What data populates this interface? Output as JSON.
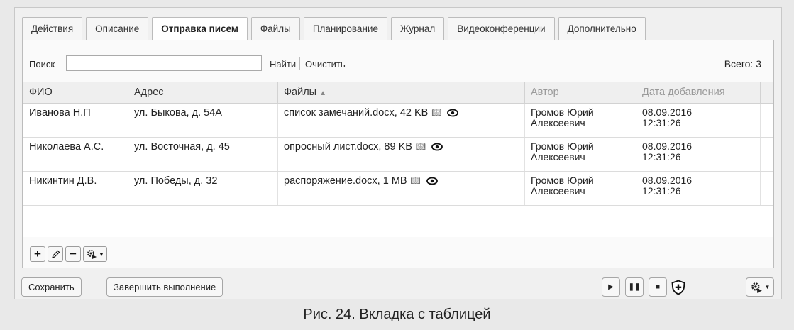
{
  "tabs": [
    "Действия",
    "Описание",
    "Отправка писем",
    "Файлы",
    "Планирование",
    "Журнал",
    "Видеоконференции",
    "Дополнительно"
  ],
  "active_tab": "Отправка писем",
  "search": {
    "label": "Поиск",
    "value": "",
    "find_label": "Найти",
    "clear_label": "Очистить",
    "total_text": "Всего: 3"
  },
  "table": {
    "columns": [
      "ФИО",
      "Адрес",
      "Файлы",
      "Автор",
      "Дата добавления"
    ],
    "sorted_column": "Файлы",
    "rows": [
      {
        "fio": "Иванова Н.П",
        "address": "ул. Быкова, д. 54А",
        "file": "список замечаний.docx, 42 KB",
        "author_line1": "Громов Юрий",
        "author_line2": "Алексеевич",
        "date_line1": "08.09.2016",
        "date_line2": "12:31:26"
      },
      {
        "fio": "Николаева А.С.",
        "address": "ул. Восточная, д. 45",
        "file": "опросный лист.docx, 89 KB",
        "author_line1": "Громов Юрий",
        "author_line2": "Алексеевич",
        "date_line1": "08.09.2016",
        "date_line2": "12:31:26"
      },
      {
        "fio": "Никинтин Д.В.",
        "address": "ул. Победы, д. 32",
        "file": "распоряжение.docx, 1 MB",
        "author_line1": "Громов Юрий",
        "author_line2": "Алексеевич",
        "date_line1": "08.09.2016",
        "date_line2": "12:31:26"
      }
    ]
  },
  "toolbar": {
    "icons": [
      "plus-icon",
      "pencil-icon",
      "minus-icon",
      "gear-play-icon"
    ]
  },
  "footer": {
    "save_label": "Сохранить",
    "finish_label": "Завершить выполнение",
    "controls": [
      "play-icon",
      "pause-icon",
      "stop-icon",
      "shield-plus-icon",
      "gear-play-icon"
    ]
  },
  "caption": "Рис. 24. Вкладка с таблицей",
  "colors": {
    "background": "#e9e9e9",
    "panel": "#f0f0f0",
    "header_bg": "#efefef",
    "dim_header_text": "#9a9a9a"
  }
}
